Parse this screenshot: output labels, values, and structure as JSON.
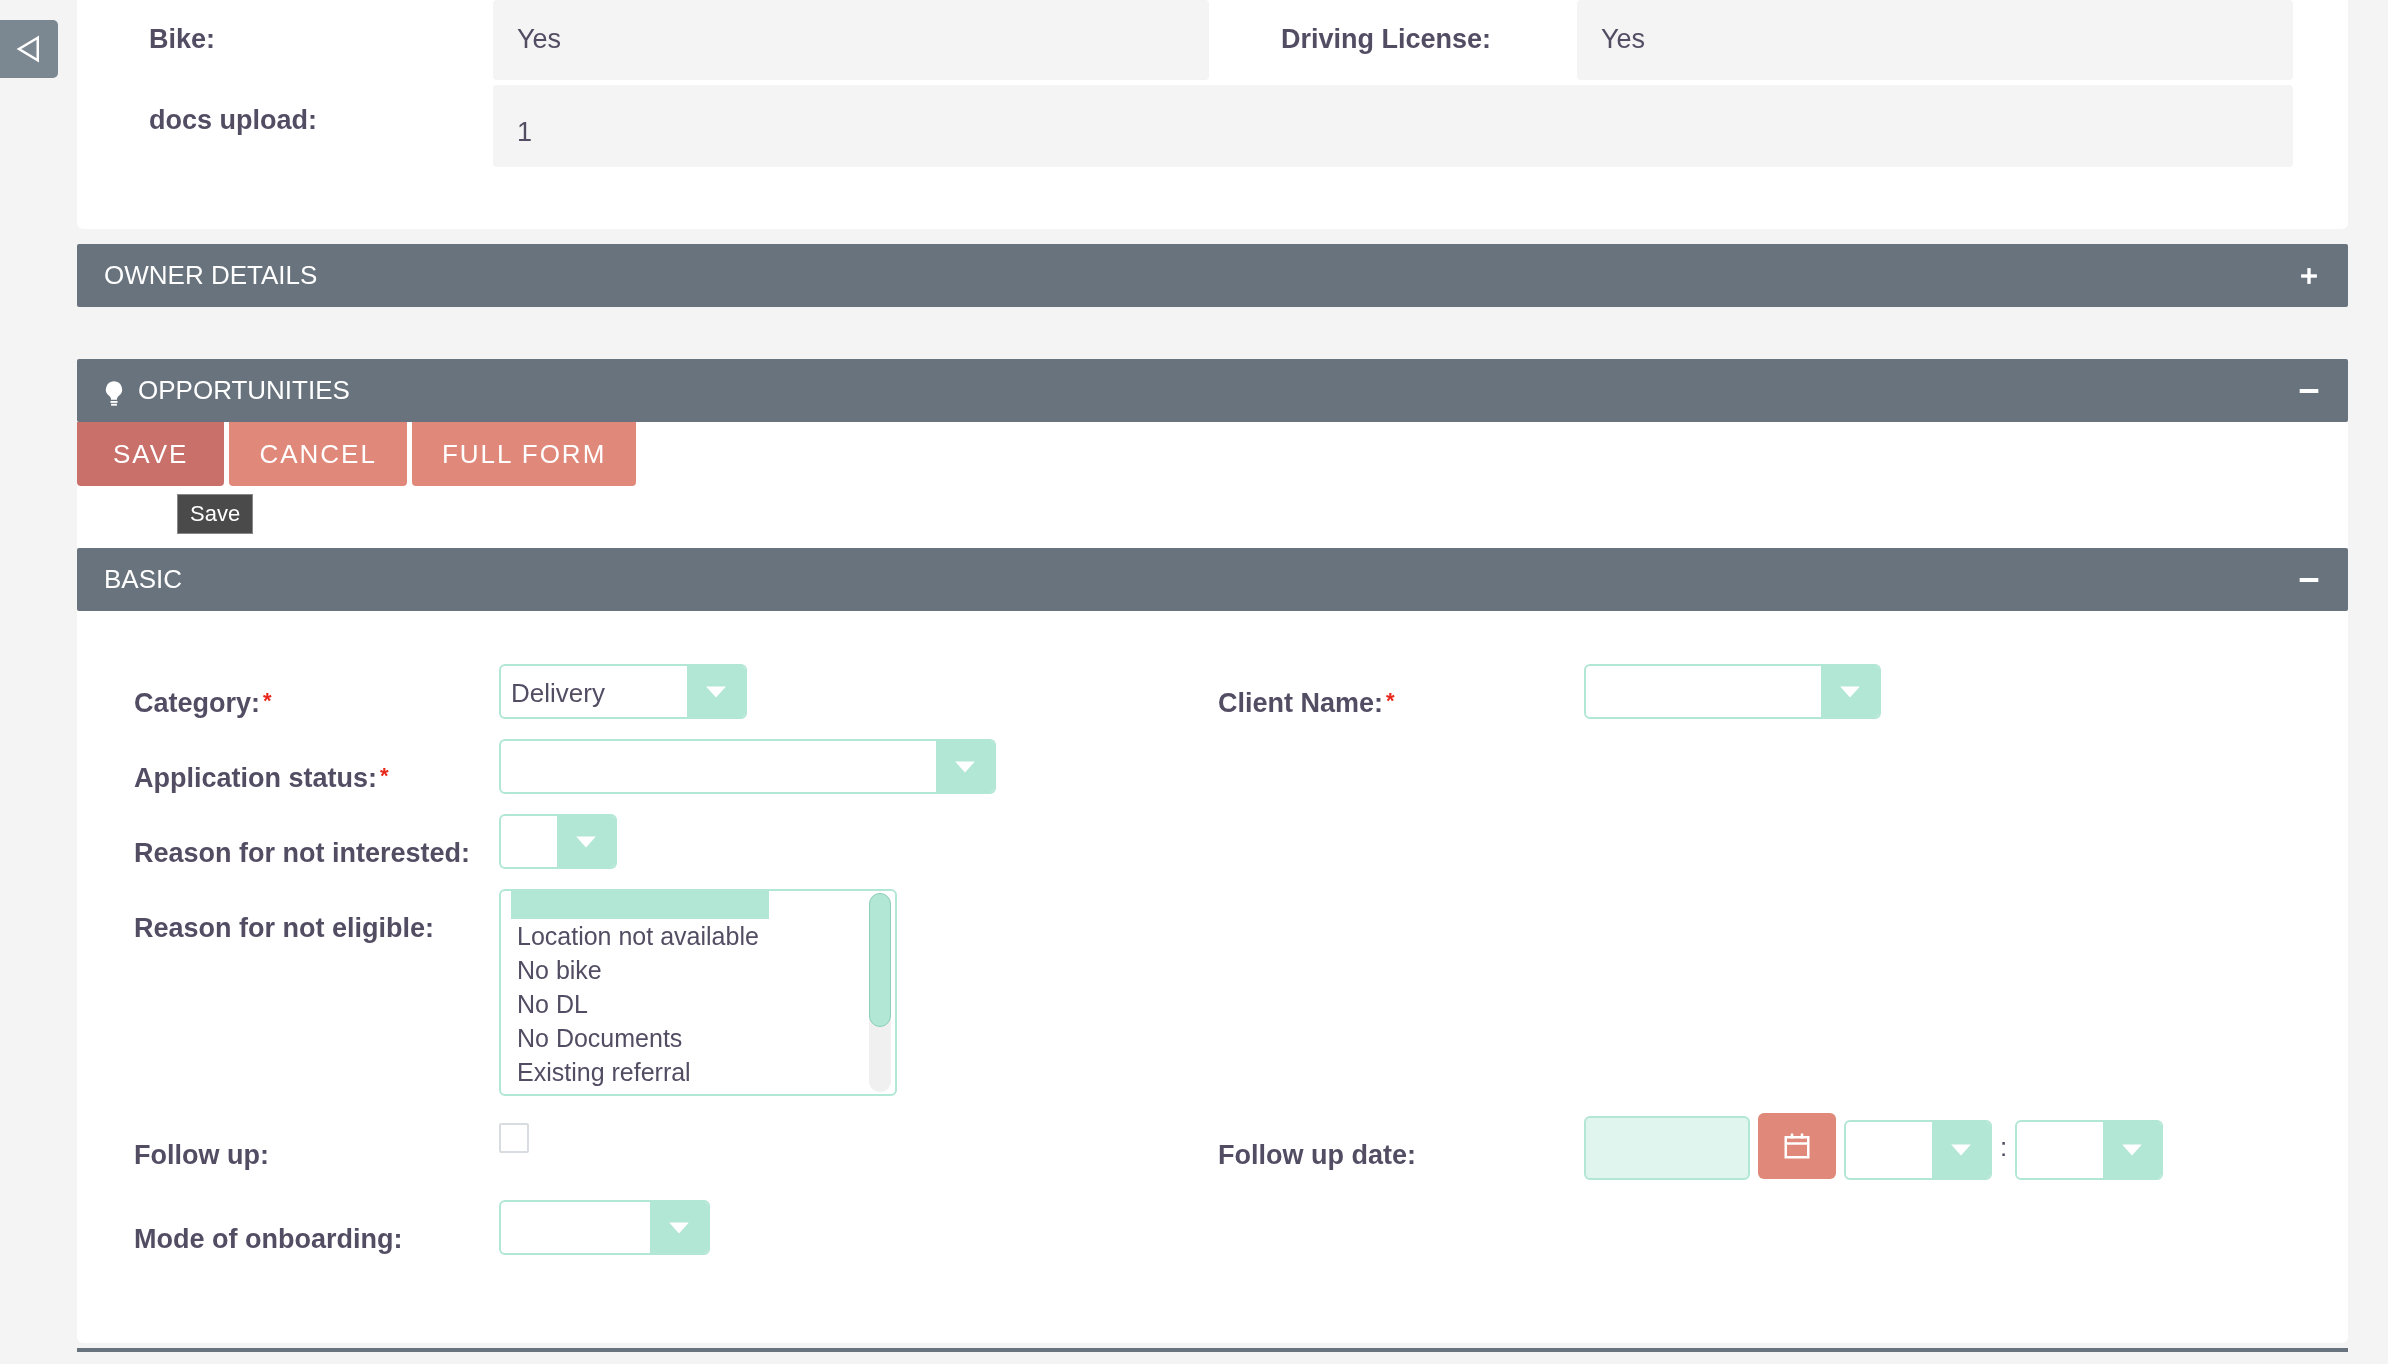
{
  "detail_rows": [
    {
      "fields": [
        {
          "label": "Bike:",
          "value": "Yes"
        },
        {
          "label": "Driving License:",
          "value": "Yes"
        }
      ]
    },
    {
      "fields": [
        {
          "label": "docs upload:",
          "value": "1"
        }
      ]
    }
  ],
  "owner_details": {
    "title": "OWNER DETAILS",
    "expanded": false
  },
  "opportunities": {
    "title": "OPPORTUNITIES",
    "expanded": true,
    "buttons": [
      {
        "label": "SAVE",
        "hovered": true
      },
      {
        "label": "CANCEL",
        "hovered": false
      },
      {
        "label": "FULL FORM",
        "hovered": false
      }
    ],
    "tooltip": {
      "text": "Save"
    },
    "basic": {
      "title": "BASIC",
      "expanded": true,
      "rows": [
        {
          "left": {
            "kind": "select",
            "label": "Category:",
            "required_marker": "*",
            "value": "Delivery"
          },
          "right": {
            "kind": "select",
            "label": "Client Name:",
            "required_marker": "*"
          }
        },
        {
          "left": {
            "kind": "select",
            "label": "Application status:",
            "required_marker": "*"
          }
        },
        {
          "left": {
            "kind": "select",
            "label": "Reason for not interested:"
          }
        },
        {
          "left": {
            "kind": "multiselect",
            "label": "Reason for not eligible:",
            "blank_option_selected": true,
            "options": [
              {
                "label": "Location not available",
                "selected": false
              },
              {
                "label": "No bike",
                "selected": false
              },
              {
                "label": "No DL",
                "selected": false
              },
              {
                "label": "No Documents",
                "selected": false
              },
              {
                "label": "Existing referral",
                "selected": false
              }
            ]
          }
        },
        {
          "left": {
            "kind": "checkbox",
            "label": "Follow up:",
            "checked": false
          },
          "right": {
            "kind": "datetime",
            "label": "Follow up date:",
            "separator": ":"
          }
        },
        {
          "left": {
            "kind": "select",
            "label": "Mode of onboarding:"
          }
        }
      ]
    }
  }
}
